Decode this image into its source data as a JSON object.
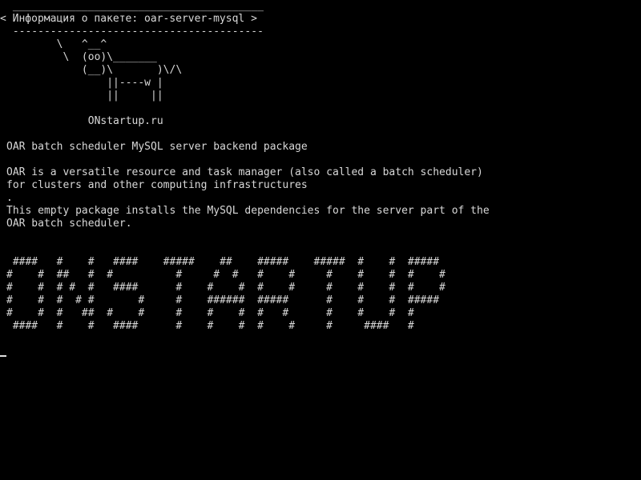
{
  "terminal": {
    "bubble": {
      "top_border": " ________________________________________",
      "title": "< Информация о пакете: oar-server-mysql >",
      "bottom_border": " ----------------------------------------"
    },
    "cow": {
      "line1": "        \\   ^__^",
      "line2": "         \\  (oo)\\_______",
      "line3": "            (__)\\       )\\/\\",
      "line4": "                ||----w |",
      "line5": "                ||     ||",
      "site": "             ONstartup.ru"
    },
    "summary": "OAR batch scheduler MySQL server backend package",
    "description": {
      "line1": "OAR is a versatile resource and task manager (also called a batch scheduler)",
      "line2": "for clusters and other computing infrastructures",
      "line3": ".",
      "line4": "This empty package installs the MySQL dependencies for the server part of the",
      "line5": "OAR batch scheduler."
    },
    "banner": {
      "line1": " ####   #    #   ####    #####    ##    #####    #####  #    #  #####",
      "line2": "#    #  ##   #  #          #     #  #   #    #     #    #    #  #    #",
      "line3": "#    #  # #  #   ####      #    #    #  #    #     #    #    #  #    #",
      "line4": "#    #  #  # #       #     #    ######  #####      #    #    #  #####",
      "line5": "#    #  #   ##  #    #     #    #    #  #   #      #    #    #  #",
      "line6": " ####   #    #   ####      #    #    #  #    #     #     ####   #"
    }
  }
}
